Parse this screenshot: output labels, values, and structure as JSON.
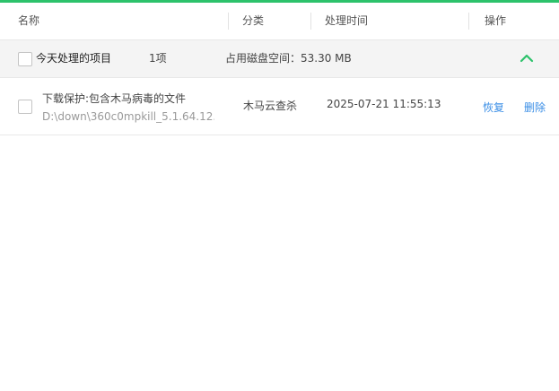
{
  "header": {
    "col_name": "名称",
    "col_category": "分类",
    "col_time": "处理时间",
    "col_action": "操作"
  },
  "group": {
    "title": "今天处理的项目",
    "count": "1项",
    "disk_usage": "占用磁盘空间：53.30 MB",
    "toggle_icon": "chevron-up-icon"
  },
  "rows": [
    {
      "title": "下载保护:包含木马病毒的文件",
      "path": "D:\\down\\360c0mpkill_5.1.64.12...",
      "category": "木马云查杀",
      "time": "2025-07-21 11:55:13",
      "restore_label": "恢复",
      "delete_label": "删除"
    }
  ],
  "colors": {
    "accent_green": "#2dc26b",
    "link_blue": "#3a8ee6",
    "group_bg": "#f4f4f4"
  }
}
